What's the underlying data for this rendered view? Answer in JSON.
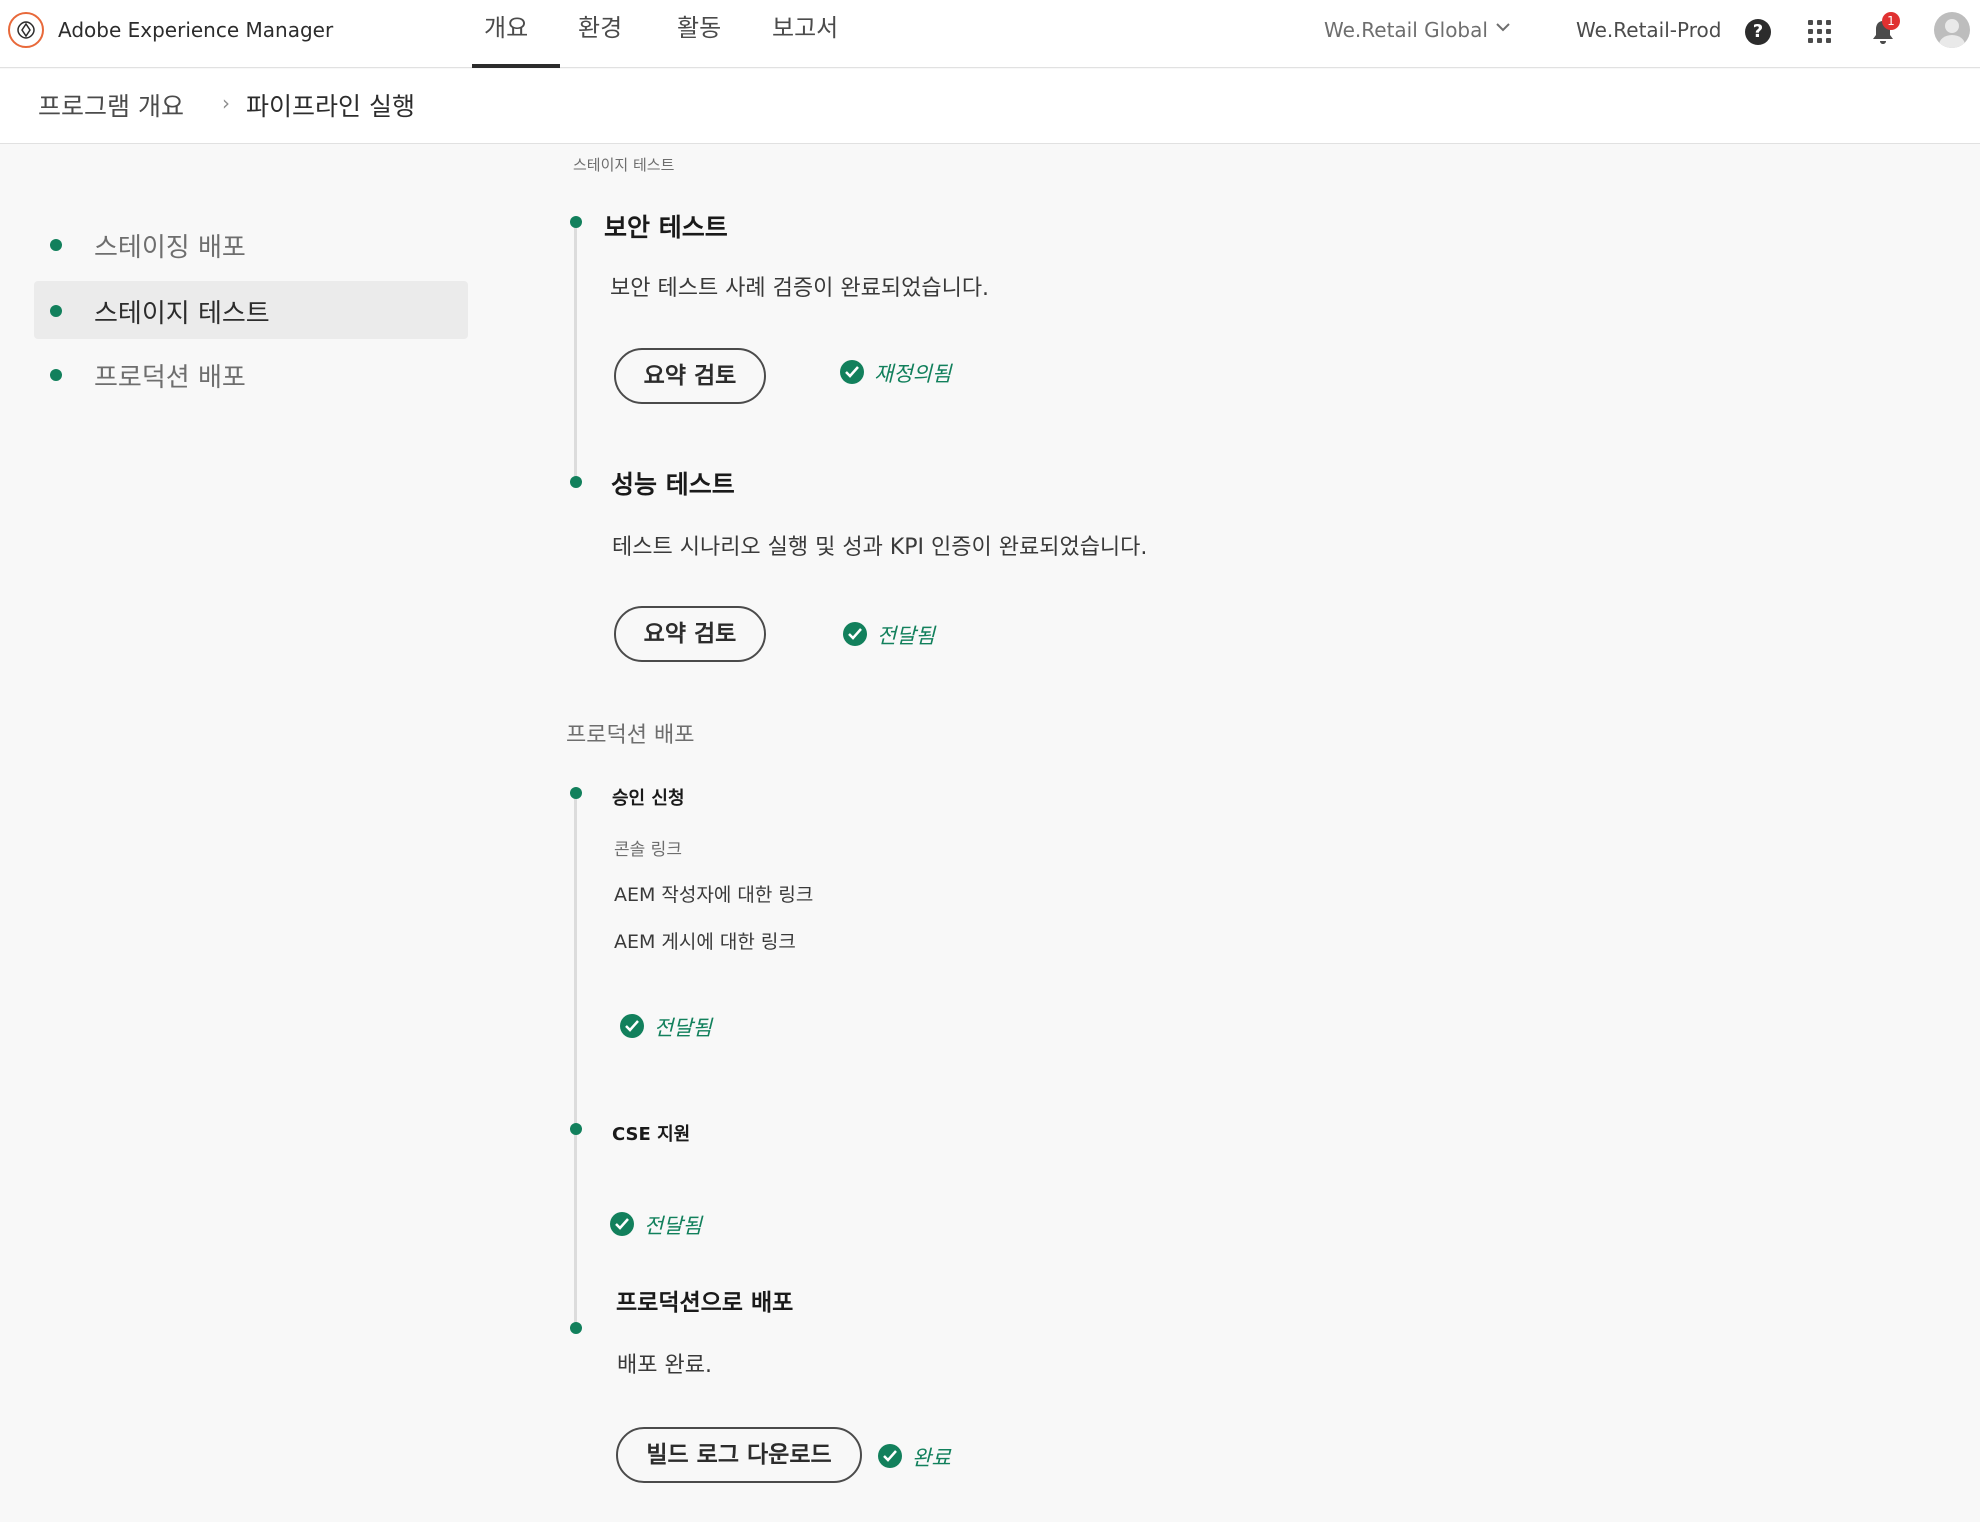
{
  "topbar": {
    "app_name": "Adobe Experience Manager",
    "tabs": [
      "개요",
      "환경",
      "활동",
      "보고서"
    ],
    "org": "We.Retail Global",
    "program": "We.Retail-Prod",
    "notification_count": "1",
    "icons": [
      "aem-logo-icon",
      "chevron-down-icon",
      "help-icon",
      "apps-grid-icon",
      "bell-icon",
      "avatar"
    ]
  },
  "breadcrumb": {
    "items": [
      "프로그램 개요",
      "파이프라인 실행"
    ],
    "separator": "›"
  },
  "sidebar": {
    "items": [
      {
        "label": "스테이징 배포",
        "selected": false
      },
      {
        "label": "스테이지 테스트",
        "selected": true
      },
      {
        "label": "프로덕션 배포",
        "selected": false
      }
    ]
  },
  "main": {
    "stage_caption": "스테이지 테스트",
    "security": {
      "title": "보안 테스트",
      "desc": "보안 테스트 사례 검증이 완료되었습니다.",
      "button": "요약 검토",
      "status": "재정의됨"
    },
    "performance": {
      "title": "성능 테스트",
      "desc": "테스트 시나리오 실행 및 성과 KPI 인증이 완료되었습니다.",
      "button": "요약 검토",
      "status": "전달됨"
    },
    "production_title": "프로덕션 배포",
    "approval": {
      "title": "승인 신청",
      "links_caption": "콘솔 링크",
      "link_author": "AEM 작성자에 대한 링크",
      "link_publish": "AEM 게시에 대한 링크",
      "status": "전달됨"
    },
    "cse": {
      "title": "CSE 지원",
      "status": "전달됨"
    },
    "deploy": {
      "title": "프로덕션으로 배포",
      "desc": "배포 완료.",
      "button": "빌드 로그 다운로드",
      "status": "완료"
    }
  },
  "colors": {
    "success_green": "#12805c",
    "logo_orange": "#e8693a",
    "badge_red": "#e03131"
  }
}
